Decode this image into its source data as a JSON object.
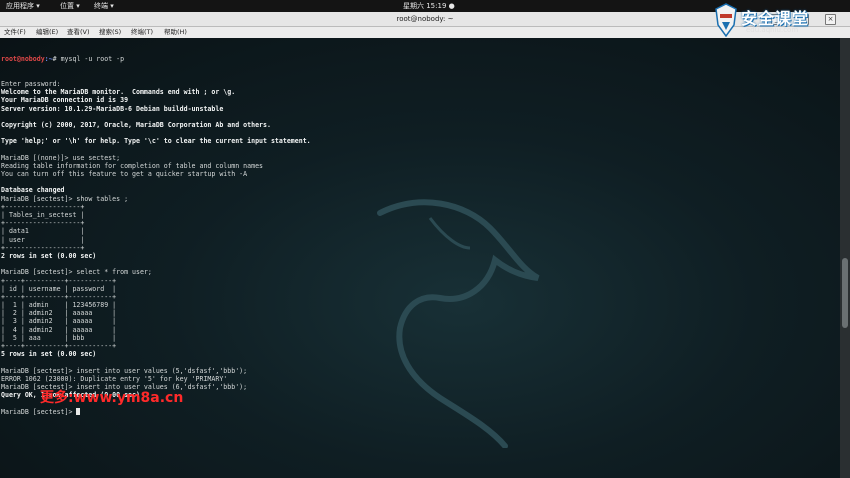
{
  "topbar": {
    "apps": "应用程序 ▾",
    "places": "位置 ▾",
    "terminal_app": "终端 ▾",
    "clock": "星期六 15:19 ●"
  },
  "window": {
    "title": "root@nobody: ~"
  },
  "menu": [
    "文件(F)",
    "编辑(E)",
    "查看(V)",
    "搜索(S)",
    "终端(T)",
    "帮助(H)"
  ],
  "terminal": {
    "prompt_user": "root@nobody",
    "prompt_path": ":~",
    "first_command": "# mysql -u root -p",
    "lines": [
      {
        "text": "Enter password:",
        "bold": false
      },
      {
        "text": "Welcome to the MariaDB monitor.  Commands end with ; or \\g.",
        "bold": true
      },
      {
        "text": "Your MariaDB connection id is 39",
        "bold": true
      },
      {
        "text": "Server version: 10.1.29-MariaDB-6 Debian buildd-unstable",
        "bold": true
      },
      {
        "text": "",
        "bold": false
      },
      {
        "text": "Copyright (c) 2000, 2017, Oracle, MariaDB Corporation Ab and others.",
        "bold": true
      },
      {
        "text": "",
        "bold": false
      },
      {
        "text": "Type 'help;' or '\\h' for help. Type '\\c' to clear the current input statement.",
        "bold": true
      },
      {
        "text": "",
        "bold": false
      },
      {
        "text": "MariaDB [(none)]> use sectest;",
        "bold": false
      },
      {
        "text": "Reading table information for completion of table and column names",
        "bold": false
      },
      {
        "text": "You can turn off this feature to get a quicker startup with -A",
        "bold": false
      },
      {
        "text": "",
        "bold": false
      },
      {
        "text": "Database changed",
        "bold": true
      },
      {
        "text": "MariaDB [sectest]> show tables ;",
        "bold": false
      },
      {
        "text": "+-------------------+",
        "bold": false
      },
      {
        "text": "| Tables_in_sectest |",
        "bold": false
      },
      {
        "text": "+-------------------+",
        "bold": false
      },
      {
        "text": "| data1             |",
        "bold": false
      },
      {
        "text": "| user              |",
        "bold": false
      },
      {
        "text": "+-------------------+",
        "bold": false
      },
      {
        "text": "2 rows in set (0.00 sec)",
        "bold": true
      },
      {
        "text": "",
        "bold": false
      },
      {
        "text": "MariaDB [sectest]> select * from user;",
        "bold": false
      },
      {
        "text": "+----+----------+-----------+",
        "bold": false
      },
      {
        "text": "| id | username | password  |",
        "bold": false
      },
      {
        "text": "+----+----------+-----------+",
        "bold": false
      },
      {
        "text": "|  1 | admin    | 123456789 |",
        "bold": false
      },
      {
        "text": "|  2 | admin2   | aaaaa     |",
        "bold": false
      },
      {
        "text": "|  3 | admin2   | aaaaa     |",
        "bold": false
      },
      {
        "text": "|  4 | admin2   | aaaaa     |",
        "bold": false
      },
      {
        "text": "|  5 | aaa      | bbb       |",
        "bold": false
      },
      {
        "text": "+----+----------+-----------+",
        "bold": false
      },
      {
        "text": "5 rows in set (0.00 sec)",
        "bold": true
      },
      {
        "text": "",
        "bold": false
      },
      {
        "text": "MariaDB [sectest]> insert into user values (5,'dsfasf','bbb');",
        "bold": false
      },
      {
        "text": "ERROR 1062 (23000): Duplicate entry '5' for key 'PRIMARY'",
        "bold": false
      },
      {
        "text": "MariaDB [sectest]> insert into user values (6,'dsfasf','bbb');",
        "bold": false
      },
      {
        "text": "Query OK, 1 row affected (0.00 sec)",
        "bold": true
      },
      {
        "text": "",
        "bold": false
      }
    ],
    "current_prompt": "MariaDB [sectest]> "
  },
  "watermark": {
    "text": "更多:www.ym8a.cn",
    "color": "#ff2a2a"
  },
  "logo": {
    "brand": "安全课堂",
    "domain": "edu.aqniu.com"
  }
}
